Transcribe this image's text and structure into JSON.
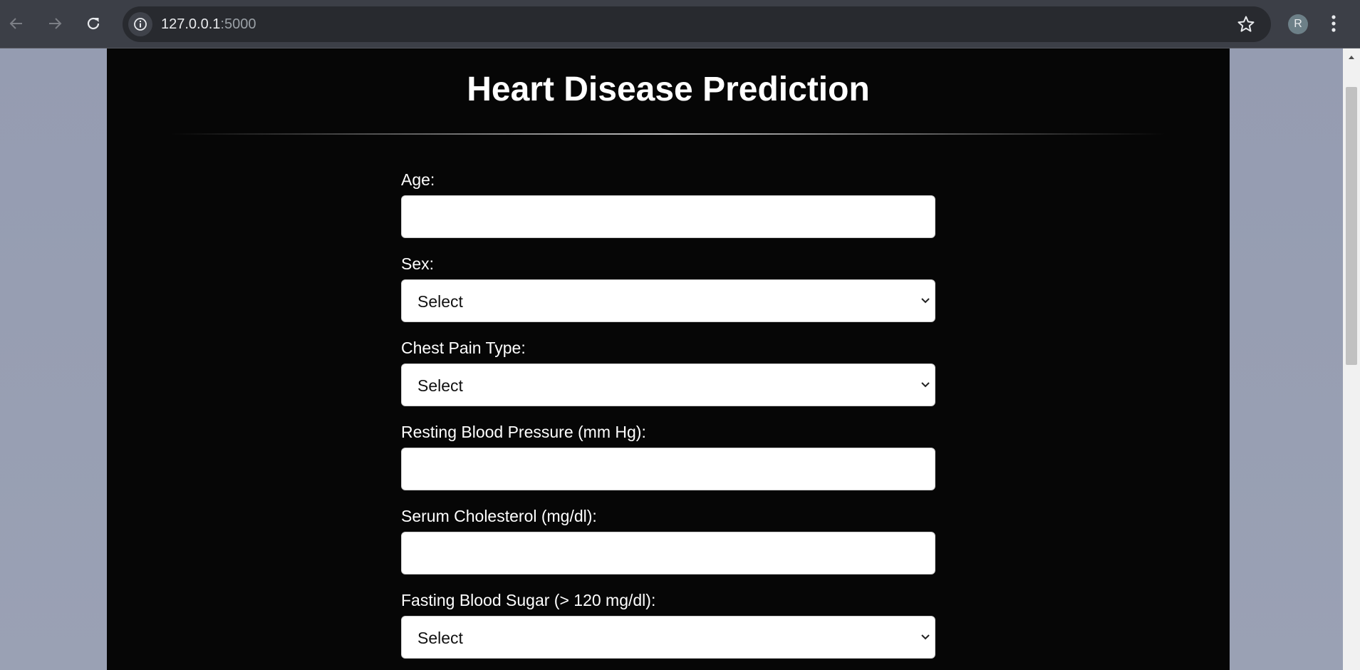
{
  "browser": {
    "url_host": "127.0.0.1",
    "url_port": ":5000",
    "profile_initial": "R",
    "icons": [
      "back-icon",
      "forward-icon",
      "reload-icon",
      "info-icon",
      "star-icon",
      "kebab-menu-icon"
    ]
  },
  "page": {
    "title": "Heart Disease Prediction",
    "fields": [
      {
        "label": "Age:",
        "type": "number",
        "value": ""
      },
      {
        "label": "Sex:",
        "type": "select",
        "value": "Select"
      },
      {
        "label": "Chest Pain Type:",
        "type": "select",
        "value": "Select"
      },
      {
        "label": "Resting Blood Pressure (mm Hg):",
        "type": "number",
        "value": ""
      },
      {
        "label": "Serum Cholesterol (mg/dl):",
        "type": "number",
        "value": ""
      },
      {
        "label": "Fasting Blood Sugar (> 120 mg/dl):",
        "type": "select",
        "value": "Select"
      }
    ]
  },
  "colors": {
    "chrome": "#3c3f47",
    "omnibox": "#282a2f",
    "page_background": "#9aa1b4",
    "container": "#060606",
    "text": "#ffffff"
  }
}
